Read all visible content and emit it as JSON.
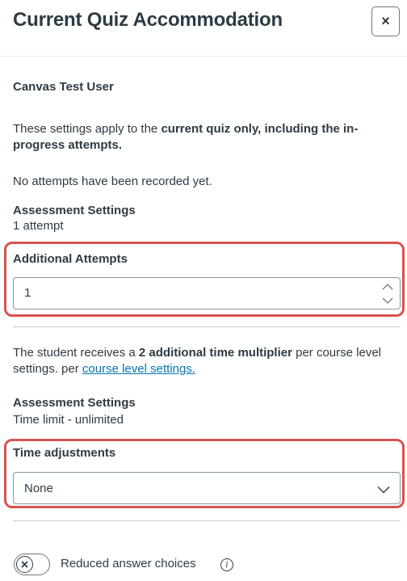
{
  "header": {
    "title": "Current Quiz Accommodation",
    "close_symbol": "×"
  },
  "user": {
    "name": "Canvas Test User"
  },
  "scope_note": {
    "prefix": "These settings apply to the ",
    "bold": "current quiz only, including the in-progress attempts."
  },
  "attempt_status": "No attempts have been recorded yet.",
  "assessment_settings_1": {
    "label": "Assessment Settings",
    "value": "1 attempt"
  },
  "additional_attempts": {
    "label": "Additional Attempts",
    "value": "1"
  },
  "multiplier_note": {
    "prefix": "The student receives a ",
    "bold": "2 additional time multiplier",
    "middle": " per course level settings. per ",
    "link": "course level settings."
  },
  "assessment_settings_2": {
    "label": "Assessment Settings",
    "value": "Time limit - unlimited"
  },
  "time_adjustments": {
    "label": "Time adjustments",
    "selected": "None"
  },
  "reduced_choices": {
    "label": "Reduced answer choices",
    "enabled": false
  },
  "colors": {
    "highlight": "#d9534f",
    "link": "#0374b5",
    "text": "#2d3b45"
  },
  "icons": {
    "close": "close-icon",
    "stepper_up": "chevron-up-icon",
    "stepper_down": "chevron-down-icon",
    "select": "chevron-down-icon",
    "toggle": "x-icon",
    "info": "info-icon"
  }
}
